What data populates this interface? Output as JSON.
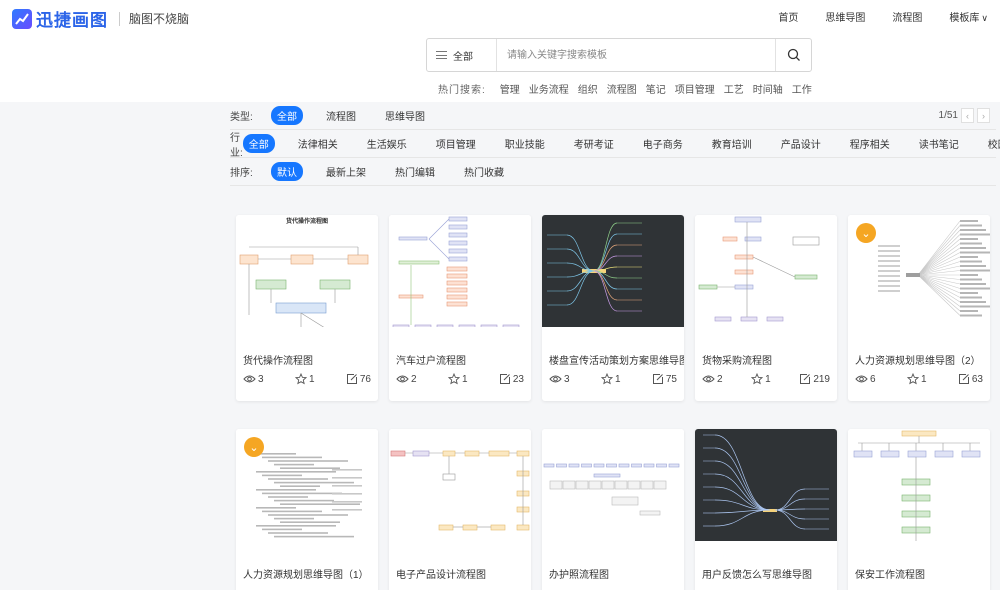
{
  "brand": {
    "name": "迅捷画图",
    "slogan": "脑图不烧脑"
  },
  "nav": {
    "items": [
      "首页",
      "思维导图",
      "流程图",
      "模板库"
    ],
    "dropdown_item": "模板库"
  },
  "search": {
    "category": "全部",
    "placeholder": "请输入关键字搜索模板"
  },
  "hot_search": {
    "label": "热门搜索:",
    "keywords": [
      "管理",
      "业务流程",
      "组织",
      "流程图",
      "笔记",
      "项目管理",
      "工艺",
      "时间轴",
      "工作"
    ]
  },
  "filters": {
    "type": {
      "label": "类型:",
      "options": [
        "全部",
        "流程图",
        "思维导图"
      ],
      "selected": "全部"
    },
    "industry": {
      "label": "行业:",
      "options": [
        "全部",
        "法律相关",
        "生活娱乐",
        "项目管理",
        "职业技能",
        "考研考证",
        "电子商务",
        "教育培训",
        "产品设计",
        "程序相关",
        "读书笔记",
        "校园教育"
      ],
      "selected": "全部"
    },
    "sort": {
      "label": "排序:",
      "options": [
        "默认",
        "最新上架",
        "热门编辑",
        "热门收藏"
      ],
      "selected": "默认"
    }
  },
  "pagination": {
    "text": "1/51"
  },
  "templates": [
    {
      "title": "货代操作流程图",
      "views": "3",
      "stars": "1",
      "edits": "76",
      "thumb_style": "light",
      "vip": false,
      "thumb_title": "货代操作流程图"
    },
    {
      "title": "汽车过户流程图",
      "views": "2",
      "stars": "1",
      "edits": "23",
      "thumb_style": "light",
      "vip": false
    },
    {
      "title": "楼盘宣传活动策划方案思维导图",
      "views": "3",
      "stars": "1",
      "edits": "75",
      "thumb_style": "dark",
      "vip": false
    },
    {
      "title": "货物采购流程图",
      "views": "2",
      "stars": "1",
      "edits": "219",
      "thumb_style": "light",
      "vip": false
    },
    {
      "title": "人力资源规划思维导图（2）",
      "views": "6",
      "stars": "1",
      "edits": "63",
      "thumb_style": "light",
      "vip": true
    },
    {
      "title": "人力资源规划思维导图（1）",
      "thumb_style": "light",
      "vip": true
    },
    {
      "title": "电子产品设计流程图",
      "thumb_style": "light",
      "vip": false
    },
    {
      "title": "办护照流程图",
      "thumb_style": "light",
      "vip": false
    },
    {
      "title": "用户反馈怎么写思维导图",
      "thumb_style": "dark",
      "vip": false
    },
    {
      "title": "保安工作流程图",
      "thumb_style": "light",
      "vip": false
    }
  ],
  "colors": {
    "accent": "#1677ff",
    "brand": "#2b64e8",
    "vip": "#f5a623",
    "dark_thumb": "#2f3336"
  }
}
